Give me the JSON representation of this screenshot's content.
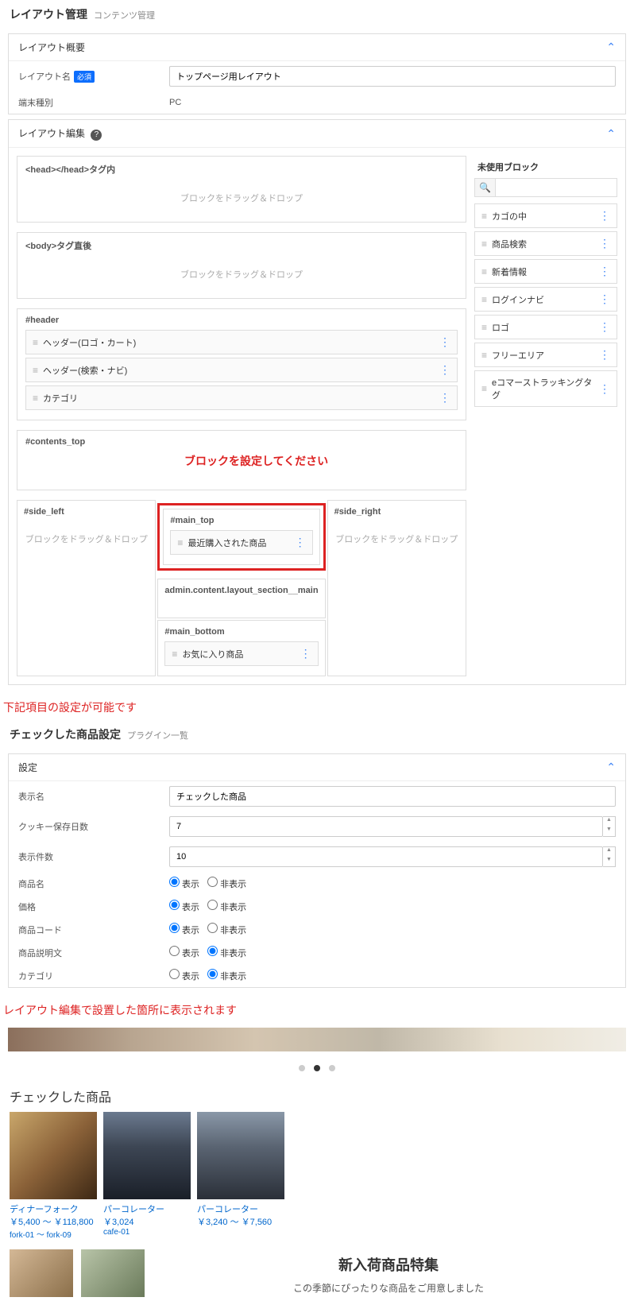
{
  "header1": {
    "title": "レイアウト管理",
    "sub": "コンテンツ管理"
  },
  "panel_overview": {
    "title": "レイアウト概要",
    "name_label": "レイアウト名",
    "req": "必須",
    "name_value": "トップページ用レイアウト",
    "device_label": "端末種別",
    "device_value": "PC"
  },
  "panel_edit": {
    "title": "レイアウト編集",
    "drop_hint": "ブロックをドラッグ＆ドロップ",
    "sec_head": "<head></head>タグ内",
    "sec_body": "<body>タグ直後",
    "sec_header": "#header",
    "header_blocks": [
      "ヘッダー(ロゴ・カート)",
      "ヘッダー(検索・ナビ)",
      "カテゴリ"
    ],
    "contents_top": "#contents_top",
    "callout": "ブロックを設定してください",
    "side_left": "#side_left",
    "main_top": "#main_top",
    "main_top_block": "最近購入された商品",
    "side_right": "#side_right",
    "section_main": "admin.content.layout_section__main",
    "main_bottom": "#main_bottom",
    "main_bottom_block": "お気に入り商品",
    "unused_title": "未使用ブロック",
    "unused_blocks": [
      "カゴの中",
      "商品検索",
      "新着情報",
      "ログインナビ",
      "ロゴ",
      "フリーエリア",
      "eコマーストラッキングタグ"
    ]
  },
  "note1": "下記項目の設定が可能です",
  "header2": {
    "title": "チェックした商品設定",
    "sub": "プラグイン一覧"
  },
  "settings": {
    "title": "設定",
    "display_name_label": "表示名",
    "display_name_value": "チェックした商品",
    "cookie_label": "クッキー保存日数",
    "cookie_value": "7",
    "count_label": "表示件数",
    "count_value": "10",
    "show": "表示",
    "hide": "非表示",
    "rows": [
      {
        "label": "商品名",
        "value": "show"
      },
      {
        "label": "価格",
        "value": "show"
      },
      {
        "label": "商品コード",
        "value": "show"
      },
      {
        "label": "商品説明文",
        "value": "hide"
      },
      {
        "label": "カテゴリ",
        "value": "hide"
      }
    ]
  },
  "note2": "レイアウト編集で設置した箇所に表示されます",
  "checked_title": "チェックした商品",
  "products": [
    {
      "name": "ディナーフォーク",
      "price": "￥5,400 ～ ￥118,800",
      "code": "fork-01 ～ fork-09",
      "cls": "p1"
    },
    {
      "name": "パーコレーター",
      "price": "￥3,024",
      "code": "cafe-01",
      "cls": "p2"
    },
    {
      "name": "パーコレーター",
      "price": "￥3,240 ～ ￥7,560",
      "code": "",
      "cls": "p3"
    }
  ],
  "feature": {
    "title": "新入荷商品特集",
    "desc": "この季節にぴったりな商品をご用意しました"
  }
}
